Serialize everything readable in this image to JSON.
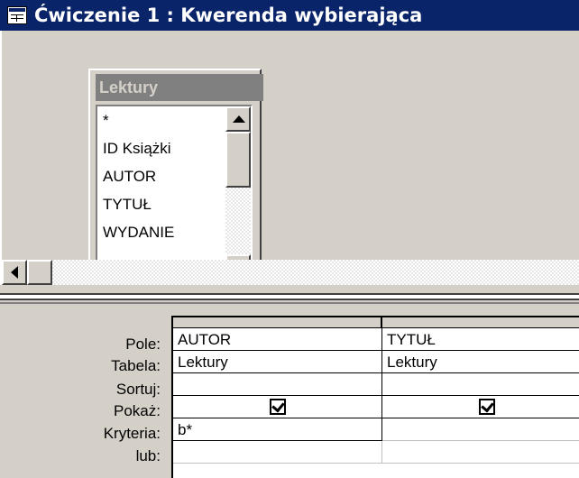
{
  "window": {
    "title": "Ćwiczenie 1 : Kwerenda wybierająca"
  },
  "table": {
    "name": "Lektury",
    "fields": [
      "*",
      "ID Książki",
      "AUTOR",
      "TYTUŁ",
      "WYDANIE"
    ]
  },
  "grid": {
    "row_labels": [
      "Pole:",
      "Tabela:",
      "Sortuj:",
      "Pokaż:",
      "Kryteria:",
      "lub:"
    ],
    "columns": [
      {
        "field": "AUTOR",
        "table": "Lektury",
        "sort": "",
        "show": true,
        "criteria": "b*",
        "or": ""
      },
      {
        "field": "TYTUŁ",
        "table": "Lektury",
        "sort": "",
        "show": true,
        "criteria": "",
        "or": ""
      }
    ]
  },
  "colors": {
    "titlebar": "#0a246a",
    "face": "#d4d0c8",
    "table_header": "#808080"
  },
  "icons": {
    "window": "query-window-icon",
    "scroll_up": "arrow-up-icon",
    "scroll_down": "arrow-down-icon",
    "scroll_left": "arrow-left-icon",
    "checkbox": "checkmark-icon"
  }
}
